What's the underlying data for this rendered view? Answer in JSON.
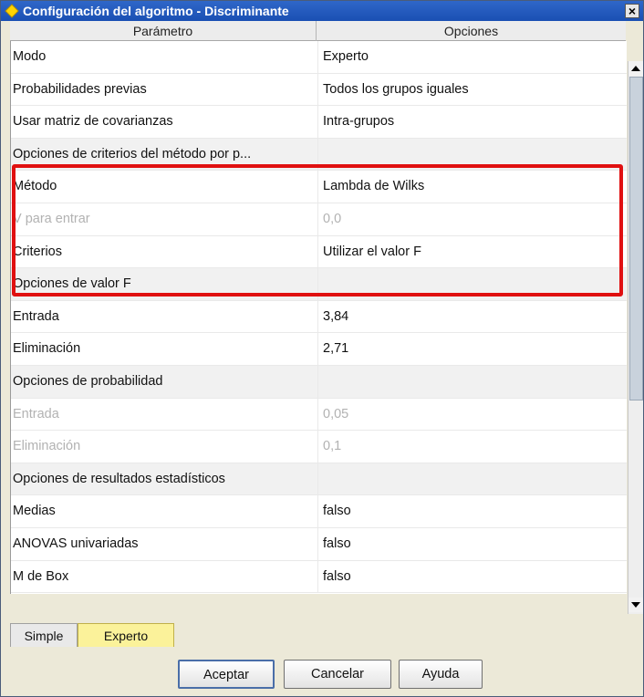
{
  "window": {
    "title": "Configuración del algoritmo - Discriminante",
    "close_label": "×"
  },
  "table": {
    "headers": [
      "Parámetro",
      "Opciones"
    ],
    "rows": [
      {
        "param": "Modo",
        "value": "Experto",
        "kind": "normal"
      },
      {
        "param": "Probabilidades previas",
        "value": "Todos los grupos iguales",
        "kind": "normal"
      },
      {
        "param": "Usar matriz de covarianzas",
        "value": "Intra-grupos",
        "kind": "normal"
      },
      {
        "param": "Opciones de criterios del método por p...",
        "value": "",
        "kind": "section"
      },
      {
        "param": "Método",
        "value": "Lambda de Wilks",
        "kind": "normal"
      },
      {
        "param": "V para entrar",
        "value": "0,0",
        "kind": "disabled"
      },
      {
        "param": "Criterios",
        "value": "Utilizar el valor F",
        "kind": "normal"
      },
      {
        "param": "Opciones de valor F",
        "value": "",
        "kind": "section"
      },
      {
        "param": "Entrada",
        "value": "3,84",
        "kind": "normal"
      },
      {
        "param": "Eliminación",
        "value": "2,71",
        "kind": "normal"
      },
      {
        "param": "Opciones de probabilidad",
        "value": "",
        "kind": "section"
      },
      {
        "param": "Entrada",
        "value": "0,05",
        "kind": "disabled"
      },
      {
        "param": "Eliminación",
        "value": "0,1",
        "kind": "disabled"
      },
      {
        "param": "Opciones de resultados estadísticos",
        "value": "",
        "kind": "section"
      },
      {
        "param": "Medias",
        "value": "falso",
        "kind": "normal"
      },
      {
        "param": "ANOVAS univariadas",
        "value": "falso",
        "kind": "normal"
      },
      {
        "param": "M de Box",
        "value": "falso",
        "kind": "normal"
      }
    ]
  },
  "tabs": [
    {
      "label": "Simple",
      "active": false
    },
    {
      "label": "Experto",
      "active": true
    }
  ],
  "buttons": {
    "ok": "Aceptar",
    "cancel": "Cancelar",
    "help": "Ayuda"
  },
  "colors": {
    "highlight": "#e01010",
    "active_tab": "#fbf29a",
    "titlebar": "#1a4fb3"
  },
  "icons": {
    "title": "diamond-icon",
    "scroll_up": "arrow-up-icon",
    "scroll_down": "arrow-down-icon"
  }
}
